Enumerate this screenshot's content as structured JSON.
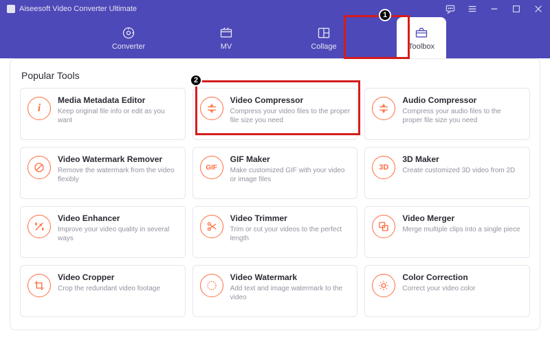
{
  "app": {
    "title": "Aiseesoft Video Converter Ultimate"
  },
  "nav": {
    "converter": "Converter",
    "mv": "MV",
    "collage": "Collage",
    "toolbox": "Toolbox"
  },
  "section": {
    "popular_tools": "Popular Tools"
  },
  "tools": [
    {
      "icon": "i",
      "title": "Media Metadata Editor",
      "desc": "Keep original file info or edit as you want"
    },
    {
      "icon": "⇣",
      "title": "Video Compressor",
      "desc": "Compress your video files to the proper file size you need"
    },
    {
      "icon": "⇣",
      "title": "Audio Compressor",
      "desc": "Compress your audio files to the proper file size you need"
    },
    {
      "icon": "⊘",
      "title": "Video Watermark Remover",
      "desc": "Remove the watermark from the video flexibly"
    },
    {
      "icon": "GIF",
      "title": "GIF Maker",
      "desc": "Make customized GIF with your video or image files"
    },
    {
      "icon": "3D",
      "title": "3D Maker",
      "desc": "Create customized 3D video from 2D"
    },
    {
      "icon": "✦",
      "title": "Video Enhancer",
      "desc": "Improve your video quality in several ways"
    },
    {
      "icon": "✂",
      "title": "Video Trimmer",
      "desc": "Trim or cut your videos to the perfect length"
    },
    {
      "icon": "⧉",
      "title": "Video Merger",
      "desc": "Merge multiple clips into a single piece"
    },
    {
      "icon": "⧉",
      "title": "Video Cropper",
      "desc": "Crop the redundant video footage"
    },
    {
      "icon": "◌",
      "title": "Video Watermark",
      "desc": "Add text and image watermark to the video"
    },
    {
      "icon": "☀",
      "title": "Color Correction",
      "desc": "Correct your video color"
    }
  ],
  "annotations": {
    "a1": "1",
    "a2": "2"
  }
}
